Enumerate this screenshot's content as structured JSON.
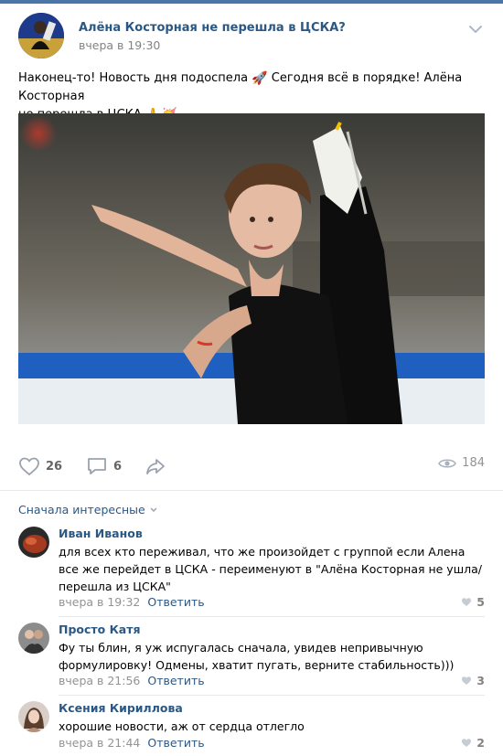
{
  "post": {
    "title": "Алёна Косторная не перешла в ЦСКА?",
    "time": "вчера в 19:30",
    "text_line1": "Наконец-то! Новость дня подоспела",
    "text_line1b": "Сегодня всё в порядке! Алёна Косторная",
    "text_line2": "не перешла в ЦСКА",
    "emoji_rocket": "🚀",
    "emoji_pray": "🙏",
    "emoji_party": "🥳"
  },
  "actions": {
    "likes": "26",
    "comments": "6",
    "views": "184"
  },
  "comments_section": {
    "sort_label": "Сначала интересные",
    "items": [
      {
        "author": "Иван Иванов",
        "text": "для всех кто переживал, что же произойдет с группой если Алена все же перейдет в ЦСКА - переименуют в \"Алёна Косторная не ушла/перешла из ЦСКА\"",
        "time": "вчера в 19:32",
        "reply": "Ответить",
        "likes": "5"
      },
      {
        "author": "Просто Катя",
        "text": "Фу ты блин, я уж испугалась сначала, увидев непривычную формулировку! Одмены, хватит пугать, верните стабильность)))",
        "time": "вчера в 21:56",
        "reply": "Ответить",
        "likes": "3"
      },
      {
        "author": "Ксения Кириллова",
        "text": "хорошие новости, аж от сердца отлегло",
        "time": "вчера в 21:44",
        "reply": "Ответить",
        "likes": "2"
      }
    ]
  },
  "colors": {
    "link": "#2a5885",
    "muted": "#828282",
    "brand": "#4a76a8"
  }
}
